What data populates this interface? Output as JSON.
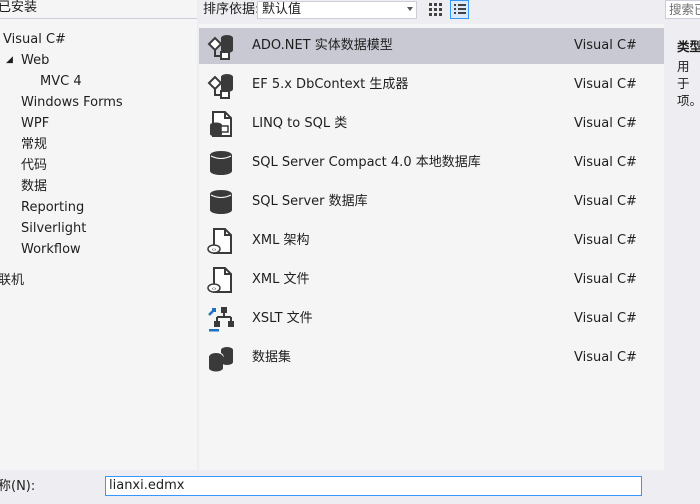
{
  "left": {
    "installed": "已安装",
    "tree": [
      {
        "label": "Visual C#",
        "level": 0,
        "selected": false
      },
      {
        "label": "Web",
        "level": 1,
        "expanded": true,
        "selected": false
      },
      {
        "label": "MVC 4",
        "level": 2,
        "selected": false
      },
      {
        "label": "Windows Forms",
        "level": 1,
        "selected": false
      },
      {
        "label": "WPF",
        "level": 1,
        "selected": false
      },
      {
        "label": "常规",
        "level": 1,
        "selected": false
      },
      {
        "label": "代码",
        "level": 1,
        "selected": false
      },
      {
        "label": "数据",
        "level": 1,
        "selected": true
      },
      {
        "label": "Reporting",
        "level": 1,
        "selected": false
      },
      {
        "label": "Silverlight",
        "level": 1,
        "selected": false
      },
      {
        "label": "Workflow",
        "level": 1,
        "selected": false
      },
      {
        "label": "联机",
        "level": 0,
        "selected": false
      }
    ]
  },
  "toolbar": {
    "sort_label": "排序依据:",
    "sort_value": "默认值",
    "view_grid_icon": "grid-view-icon",
    "view_list_icon": "list-view-icon"
  },
  "templates": [
    {
      "name": "ADO.NET 实体数据模型",
      "type": "Visual C#",
      "icon": "entity-model-icon",
      "selected": true
    },
    {
      "name": "EF 5.x DbContext 生成器",
      "type": "Visual C#",
      "icon": "dbcontext-generator-icon",
      "selected": false
    },
    {
      "name": "LINQ to SQL 类",
      "type": "Visual C#",
      "icon": "linq-to-sql-icon",
      "selected": false
    },
    {
      "name": "SQL Server Compact 4.0 本地数据库",
      "type": "Visual C#",
      "icon": "database-icon",
      "selected": false
    },
    {
      "name": "SQL Server 数据库",
      "type": "Visual C#",
      "icon": "database-icon",
      "selected": false
    },
    {
      "name": "XML 架构",
      "type": "Visual C#",
      "icon": "xml-schema-icon",
      "selected": false
    },
    {
      "name": "XML 文件",
      "type": "Visual C#",
      "icon": "xml-file-icon",
      "selected": false
    },
    {
      "name": "XSLT 文件",
      "type": "Visual C#",
      "icon": "xslt-file-icon",
      "selected": false
    },
    {
      "name": "数据集",
      "type": "Visual C#",
      "icon": "dataset-icon",
      "selected": false
    }
  ],
  "right": {
    "search_placeholder": "搜索已",
    "type_label": "类型",
    "description": "用于项。"
  },
  "bottom": {
    "name_label": "称(N):",
    "name_value": "lianxi.edmx"
  },
  "colors": {
    "selected_row": "#c9c9d4",
    "accent_border": "#3399ff"
  }
}
